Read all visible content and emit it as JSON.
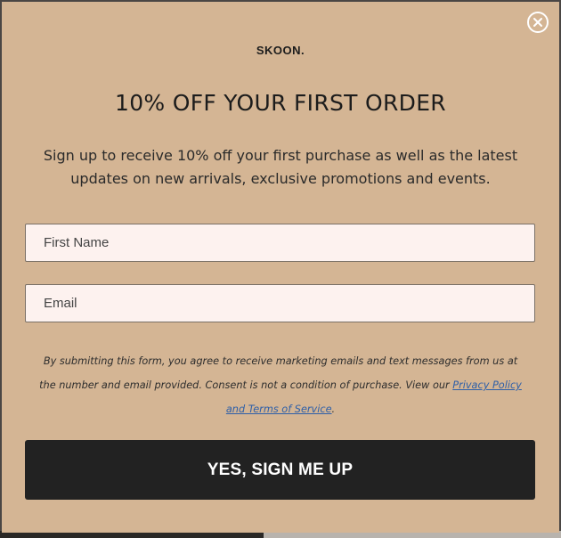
{
  "modal": {
    "brand": "SKOON.",
    "headline": "10% OFF YOUR FIRST ORDER",
    "subtext": "Sign up to receive 10% off your first purchase as well as the latest updates on new arrivals, exclusive promotions and events.",
    "close_icon": "close-icon",
    "colors": {
      "background": "#d4b594",
      "button": "#222222",
      "input_bg": "#fdf2ef",
      "link": "#2e5fa8"
    }
  },
  "form": {
    "first_name_placeholder": "First Name",
    "email_placeholder": "Email",
    "disclaimer_text": "By submitting this form, you agree to receive marketing emails and text messages from us at the number and email provided. Consent is not a condition of purchase. View our ",
    "privacy_link_text": "Privacy Policy and Terms of Service",
    "disclaimer_end": ".",
    "submit_label": "YES, SIGN ME UP"
  }
}
